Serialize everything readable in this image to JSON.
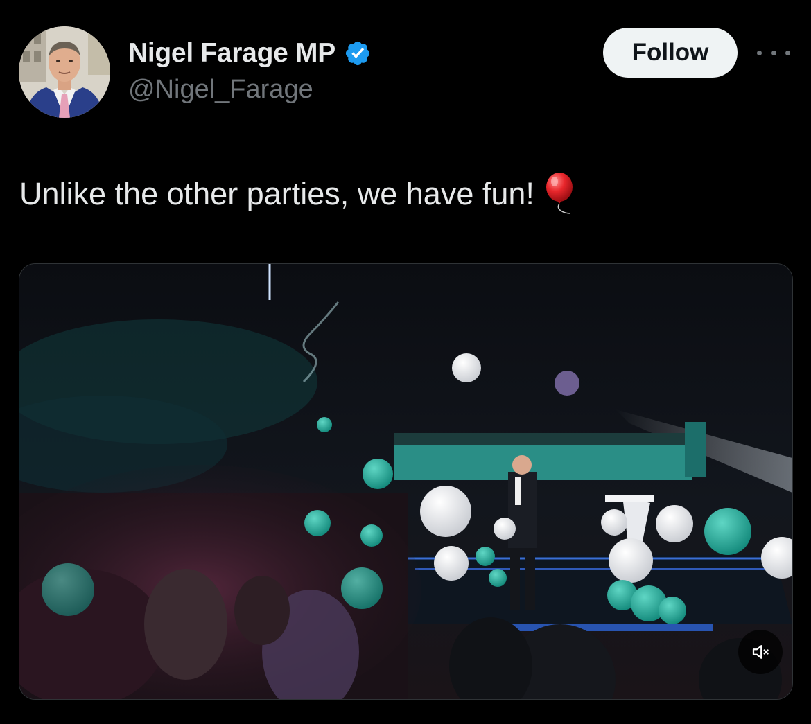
{
  "author": {
    "display_name": "Nigel Farage MP",
    "handle": "@Nigel_Farage",
    "verified": true,
    "verified_color": "#1d9bf0"
  },
  "actions": {
    "follow_label": "Follow",
    "more_icon": "more-horizontal-icon"
  },
  "tweet": {
    "text": "Unlike the other parties, we have fun!",
    "emoji_icon": "balloon-icon"
  },
  "media": {
    "type": "video",
    "mute_icon": "speaker-muted-icon"
  },
  "colors": {
    "background": "#000000",
    "primary_text": "#e7e9ea",
    "secondary_text": "#71767b",
    "follow_bg": "#eff3f4",
    "follow_text": "#0f1419",
    "balloon_teal": "#2bb3a0"
  }
}
